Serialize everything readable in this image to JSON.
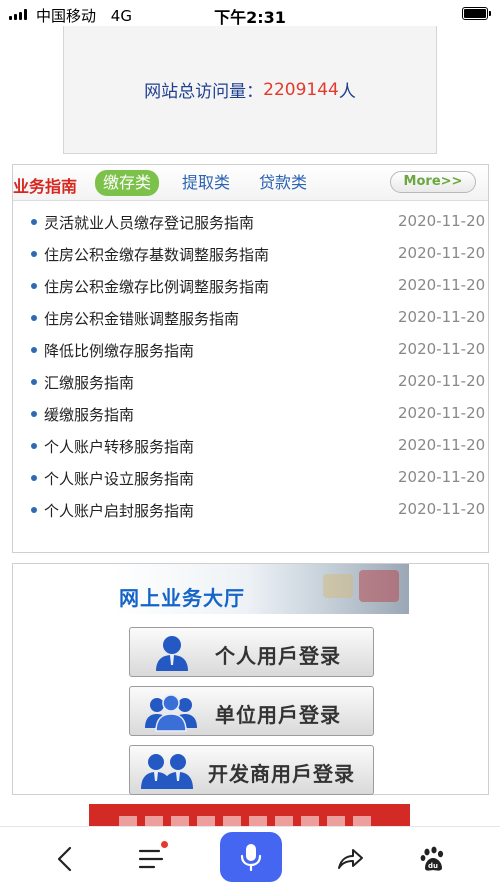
{
  "status_bar": {
    "carrier": "中国移动",
    "network": "4G",
    "time": "下午2:31"
  },
  "visit": {
    "label": "网站总访问量：",
    "count": "2209144",
    "unit": "人"
  },
  "guide": {
    "title": "业务指南",
    "tabs": [
      {
        "label": "缴存类",
        "active": true
      },
      {
        "label": "提取类",
        "active": false
      },
      {
        "label": "贷款类",
        "active": false
      }
    ],
    "more_label": "More>>",
    "items": [
      {
        "title": "灵活就业人员缴存登记服务指南",
        "date": "2020-11-20"
      },
      {
        "title": "住房公积金缴存基数调整服务指南",
        "date": "2020-11-20"
      },
      {
        "title": "住房公积金缴存比例调整服务指南",
        "date": "2020-11-20"
      },
      {
        "title": "住房公积金错账调整服务指南",
        "date": "2020-11-20"
      },
      {
        "title": "降低比例缴存服务指南",
        "date": "2020-11-20"
      },
      {
        "title": "汇缴服务指南",
        "date": "2020-11-20"
      },
      {
        "title": "缓缴服务指南",
        "date": "2020-11-20"
      },
      {
        "title": "个人账户转移服务指南",
        "date": "2020-11-20"
      },
      {
        "title": "个人账户设立服务指南",
        "date": "2020-11-20"
      },
      {
        "title": "个人账户启封服务指南",
        "date": "2020-11-20"
      }
    ]
  },
  "hall": {
    "title": "网上业务大厅",
    "buttons": [
      {
        "label": "个人用戶登录",
        "icon": "person-icon"
      },
      {
        "label": "单位用戶登录",
        "icon": "group-icon"
      },
      {
        "label": "开发商用戶登录",
        "icon": "users-pair-icon"
      }
    ]
  },
  "toolbar": {
    "icons": [
      "back-icon",
      "menu-icon",
      "microphone-icon",
      "share-icon",
      "baidu-paw-icon"
    ]
  },
  "colors": {
    "accent_blue": "#2b63b5",
    "tab_green": "#7cc24a",
    "guide_red": "#d8261e",
    "count_red": "#e23a2e",
    "mic_blue": "#4466f0"
  }
}
